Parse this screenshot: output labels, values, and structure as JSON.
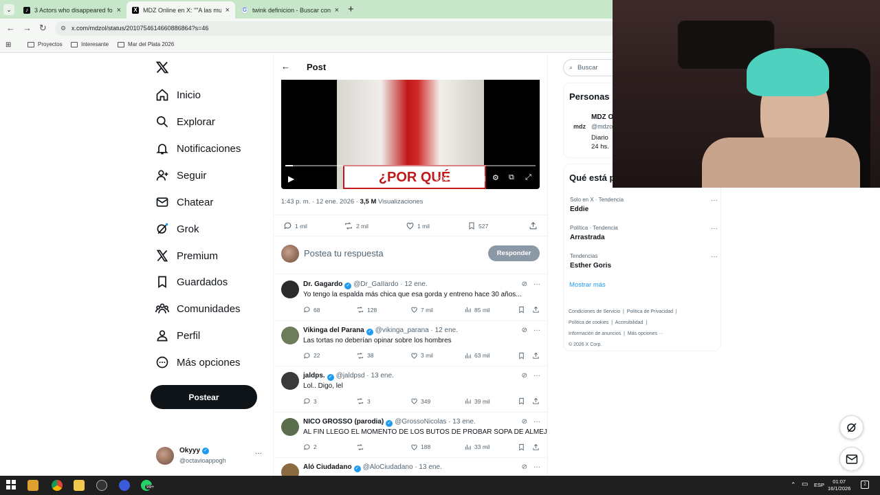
{
  "browser": {
    "tabs": [
      {
        "label": "3 Actors who disappeared for t",
        "favicon_color": "#111111"
      },
      {
        "label": "MDZ Online en X: \"\"A las mujer",
        "favicon_color": "#000000"
      },
      {
        "label": "twink definicion - Buscar con G",
        "favicon_color": "#4285f4"
      }
    ],
    "new_tab": "+",
    "url": "x.com/mdzol/status/2010754614660886864?s=46",
    "bookmarks": [
      "Proyectos",
      "Interesante",
      "Mar del Plata 2026"
    ]
  },
  "nav": {
    "logo": "X",
    "items": [
      {
        "label": "Inicio",
        "icon": "home-icon"
      },
      {
        "label": "Explorar",
        "icon": "search-icon"
      },
      {
        "label": "Notificaciones",
        "icon": "bell-icon"
      },
      {
        "label": "Seguir",
        "icon": "follow-icon"
      },
      {
        "label": "Chatear",
        "icon": "mail-icon"
      },
      {
        "label": "Grok",
        "icon": "grok-icon"
      },
      {
        "label": "Premium",
        "icon": "x-icon"
      },
      {
        "label": "Guardados",
        "icon": "bookmark-icon"
      },
      {
        "label": "Comunidades",
        "icon": "communities-icon"
      },
      {
        "label": "Perfil",
        "icon": "person-icon"
      },
      {
        "label": "Más opciones",
        "icon": "more-icon"
      }
    ],
    "post_button": "Postear",
    "account": {
      "name": "Okyyy",
      "handle": "@octavioappogh",
      "more": "···"
    }
  },
  "post": {
    "header_title": "Post",
    "video_caption": "¿POR QUÉ",
    "video_time": "0:01 / 0:46",
    "progress": 0.03,
    "meta_time": "1:43 p. m. · 12 ene. 2026 · ",
    "views_count": "3,5 M",
    "views_label": " Visualizaciones",
    "stats": {
      "replies": "1 mil",
      "reposts": "2 mil",
      "likes": "1 mil",
      "bookmarks": "527"
    },
    "composer_placeholder": "Postea tu respuesta",
    "reply_button": "Responder"
  },
  "replies": [
    {
      "name": "Dr. Gagardo",
      "handle": "@Dr_GaIIardo · 12 ene.",
      "text": "Yo tengo la espalda más chica que esa gorda y entreno hace 30 años...",
      "replies": "68",
      "reposts": "128",
      "likes": "7 mil",
      "views": "85 mil",
      "avatar_color": "#2b2b2b"
    },
    {
      "name": "Vikinga del Parana",
      "handle": "@vikinga_parana · 12 ene.",
      "text": "Las tortas no deberían opinar sobre los hombres",
      "replies": "22",
      "reposts": "38",
      "likes": "3 mil",
      "views": "63 mil",
      "avatar_color": "#6b7d5a"
    },
    {
      "name": "jaldps.",
      "handle": "@jaldpsd · 13 ene.",
      "text": "Lol.. Digo, lel",
      "replies": "3",
      "reposts": "3",
      "likes": "349",
      "views": "39 mil",
      "avatar_color": "#3a3a3a"
    },
    {
      "name": "NICO GROSSO (parodia)",
      "handle": "@GrossoNicolas · 13 ene.",
      "text": "AL FIN LLEGO EL MOMENTO DE LOS BUTOS DE PROBAR SOPA DE ALMEJA",
      "replies": "2",
      "reposts": "",
      "likes": "188",
      "views": "33 mil",
      "avatar_color": "#5a6e4e"
    },
    {
      "name": "Aló Ciudadano",
      "handle": "@AloCiudadano · 13 ene.",
      "text": "",
      "replies": "",
      "reposts": "",
      "likes": "",
      "views": "",
      "avatar_color": "#8a6a40"
    }
  ],
  "right": {
    "search_placeholder": "Buscar",
    "people_title": "Personas",
    "person": {
      "name": "MDZ O",
      "handle": "@mdzo",
      "bio1": "Diario",
      "bio2": "24 hs.",
      "logo": "mdz"
    },
    "trending_title": "Qué está p",
    "trends": [
      {
        "context": "Solo en X · Tendencia",
        "name": "Eddie"
      },
      {
        "context": "Política · Tendencia",
        "name": "Arrastrada"
      },
      {
        "context": "Tendencias",
        "name": "Esther Goris"
      }
    ],
    "show_more": "Mostrar más",
    "footer": {
      "line1a": "Condiciones de Servicio",
      "line1b": "Política de Privacidad",
      "line2a": "Política de cookies",
      "line2b": "Accesibilidad",
      "line3a": "Información de anuncios",
      "line3b": "Más opciones ···",
      "copyright": "© 2026 X Corp."
    }
  },
  "overlay": {
    "social": [
      {
        "icon": "instagram-icon",
        "label": "@octavioappogh"
      },
      {
        "icon": "x-icon",
        "label": "@octavioappogh"
      },
      {
        "icon": "tiktok-icon",
        "label": "@octavioappogh"
      },
      {
        "icon": "youtube-icon",
        "label": "Okyyy"
      },
      {
        "icon": "spotify-icon",
        "label": "Okyy"
      }
    ]
  },
  "taskbar": {
    "badge": "99+",
    "lang": "ESP",
    "time": "01:07",
    "date": "16/1/2026",
    "notif": "2"
  },
  "colors": {
    "brand": "#0f1419",
    "verified": "#1d9bf0",
    "link": "#1d9bf0",
    "tabbar": "#c8e6c9",
    "muted": "#536471"
  }
}
